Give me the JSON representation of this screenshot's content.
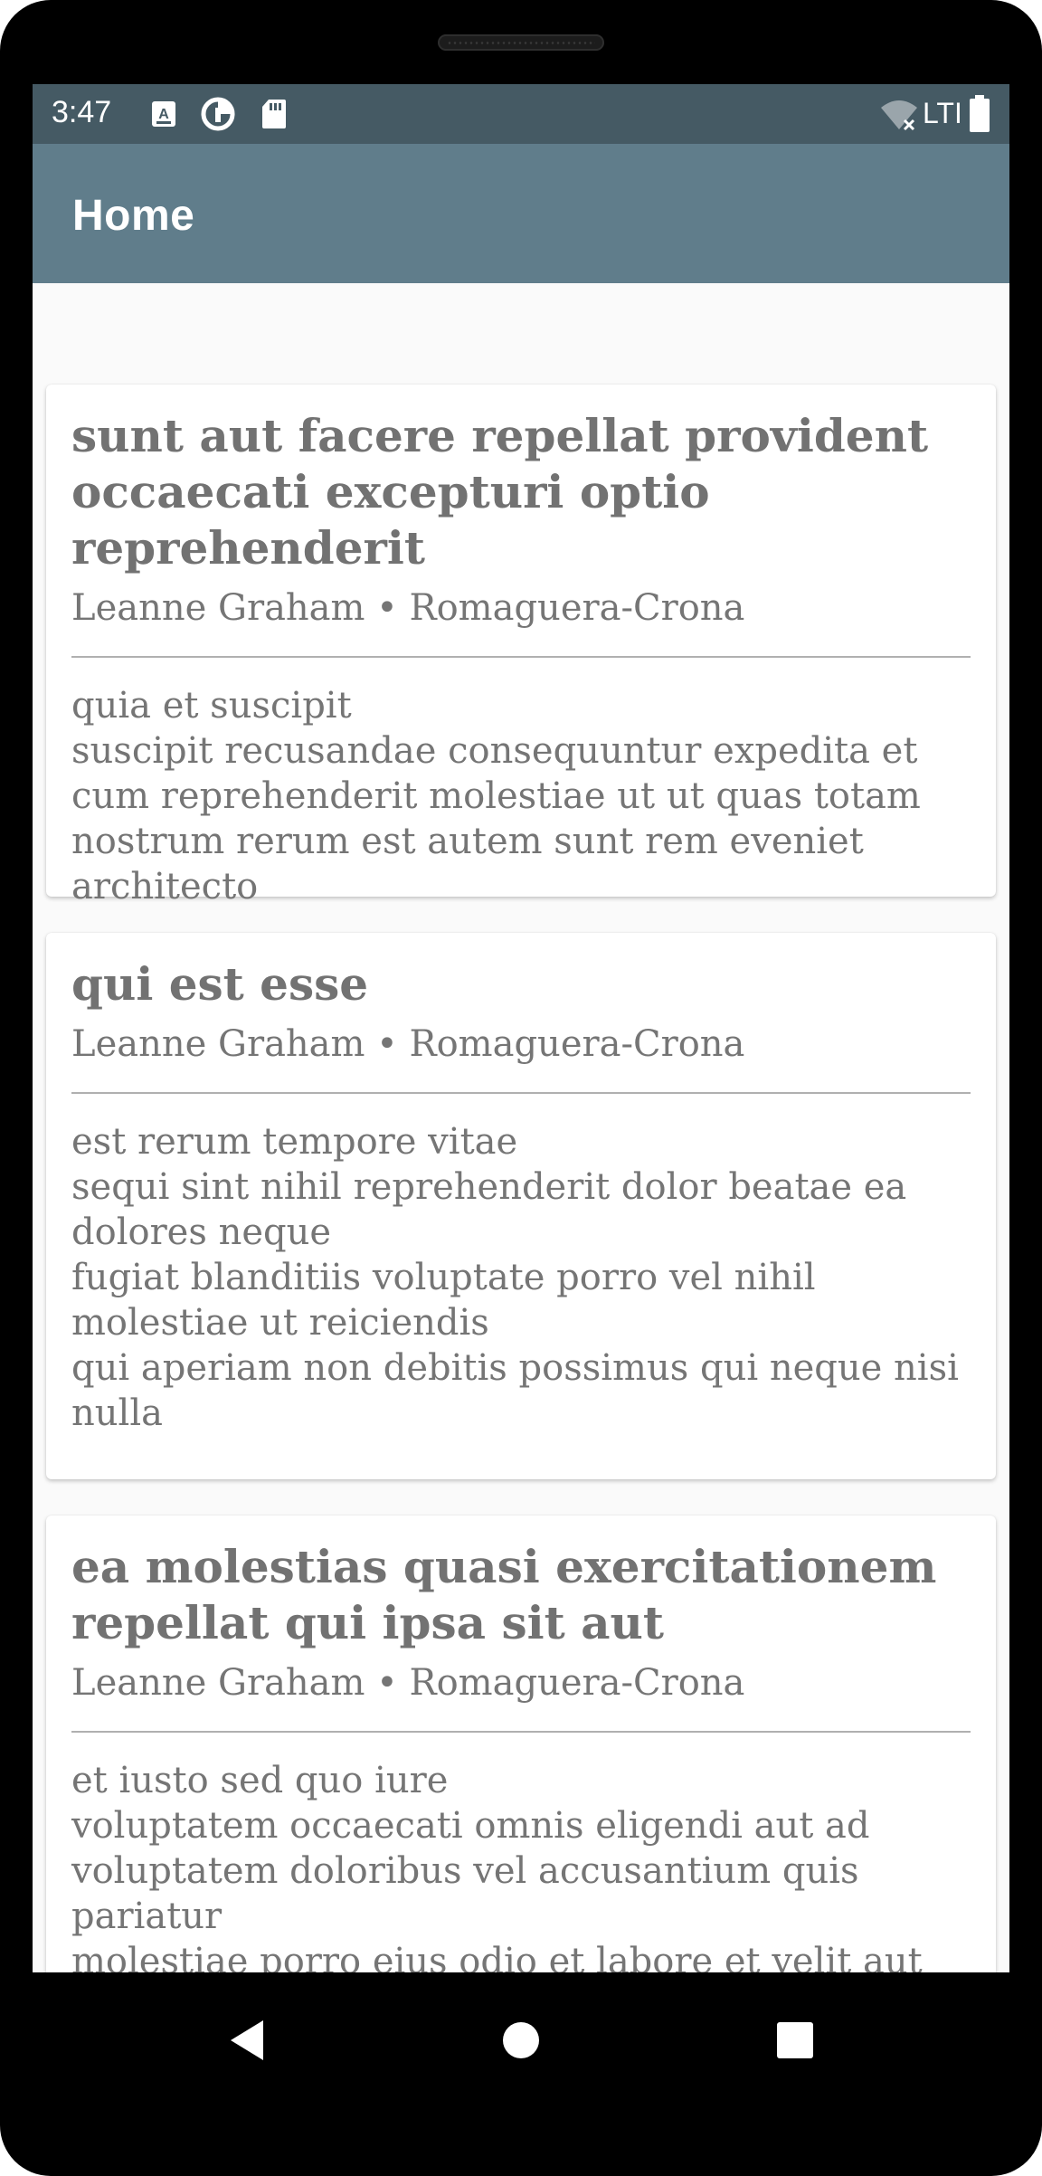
{
  "status_bar": {
    "time": "3:47",
    "icons_left": [
      "keyboard-a-icon",
      "data-saver-icon",
      "sd-card-icon"
    ],
    "icons_right": [
      "wifi-off-icon",
      "battery-icon"
    ],
    "network": "LTI"
  },
  "app_bar": {
    "title": "Home"
  },
  "posts": [
    {
      "title": "sunt aut facere repellat provident occaecati excepturi optio reprehenderit",
      "meta": "Leanne Graham • Romaguera-Crona",
      "body": "quia et suscipit\nsuscipit recusandae consequuntur expedita et cum reprehenderit molestiae ut ut quas totam\nnostrum rerum est autem sunt rem eveniet architecto"
    },
    {
      "title": "qui est esse",
      "meta": "Leanne Graham • Romaguera-Crona",
      "body": "est rerum tempore vitae\nsequi sint nihil reprehenderit dolor beatae ea dolores neque\nfugiat blanditiis voluptate porro vel nihil molestiae ut reiciendis\nqui aperiam non debitis possimus qui neque nisi nulla"
    },
    {
      "title": "ea molestias quasi exercitationem repellat qui ipsa sit aut",
      "meta": "Leanne Graham • Romaguera-Crona",
      "body": "et iusto sed quo iure\nvoluptatem occaecati omnis eligendi aut ad\nvoluptatem doloribus vel accusantium quis pariatur\nmolestiae porro eius odio et labore et velit aut"
    }
  ],
  "nav_bar": {
    "icons": [
      "back-icon",
      "home-icon",
      "recents-icon"
    ]
  },
  "colors": {
    "status_bar": "#455a64",
    "app_bar": "#607d8b",
    "text": "#757575"
  }
}
